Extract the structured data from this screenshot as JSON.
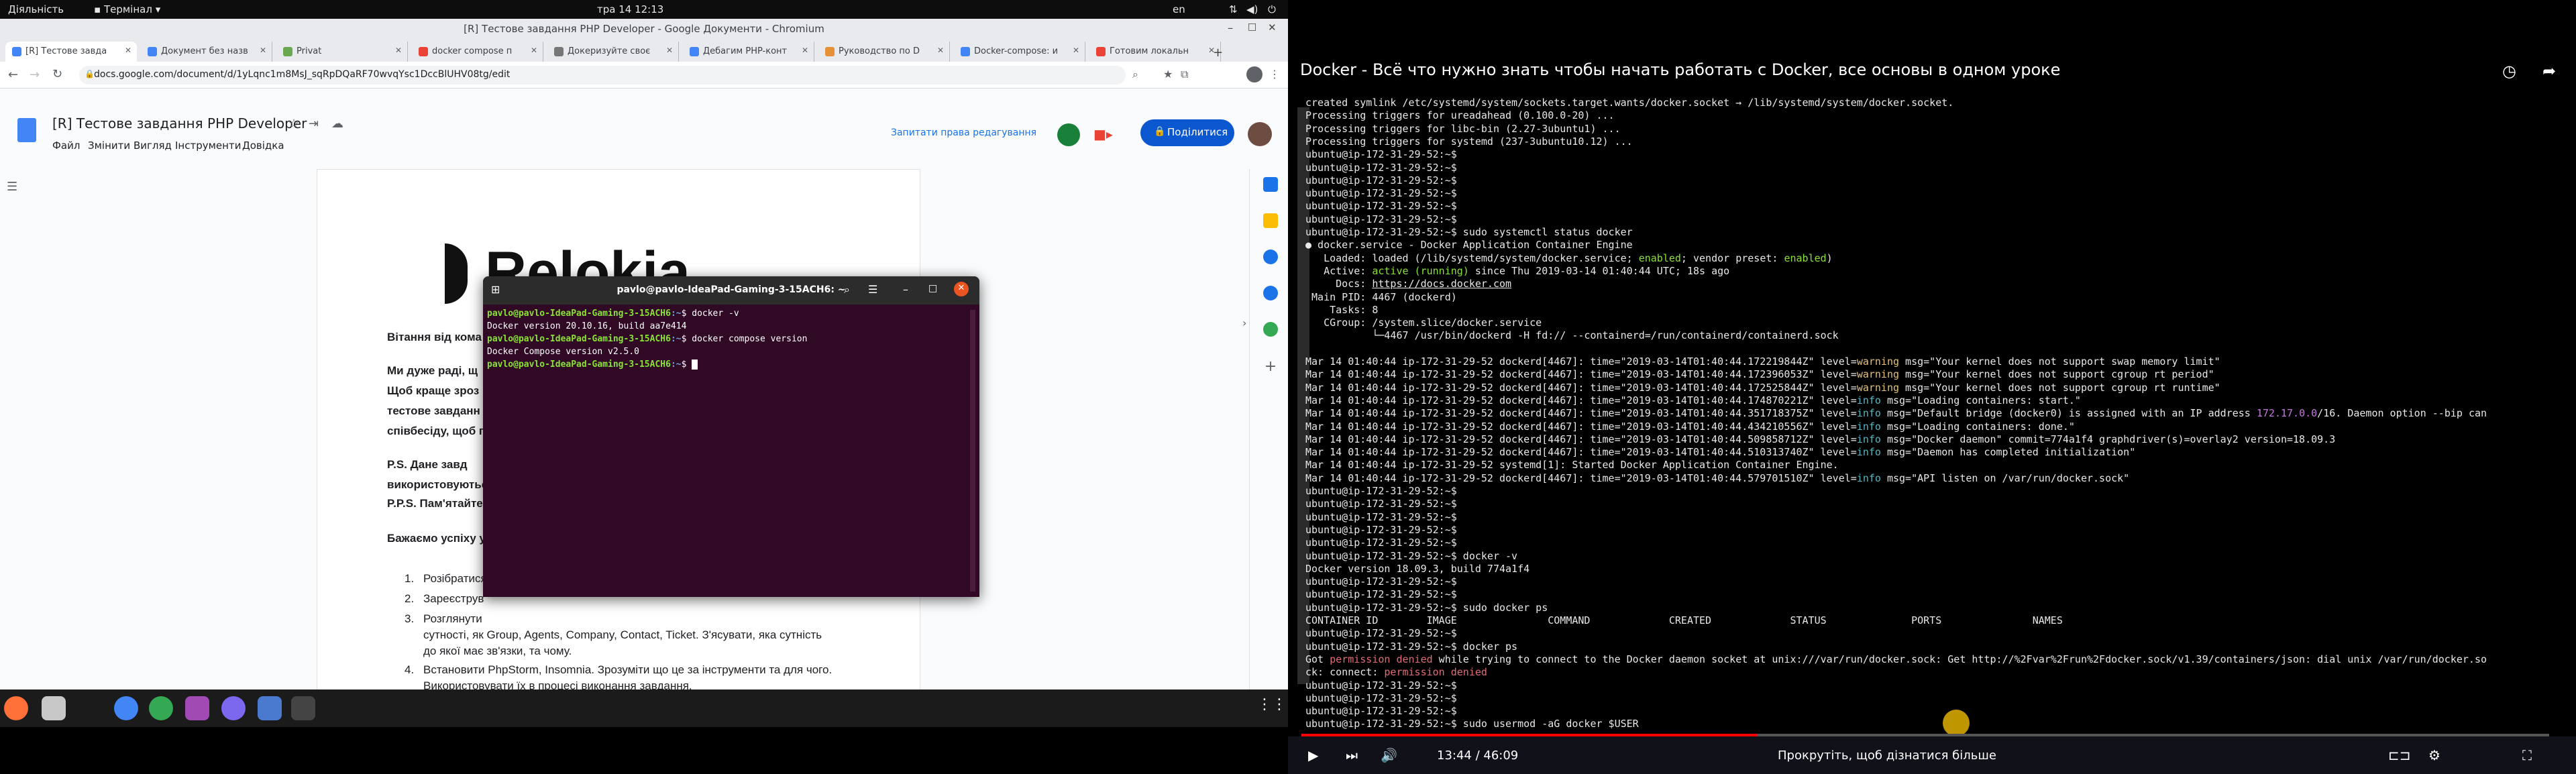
{
  "topbar": {
    "activities": "Діяльність",
    "app": "Термінал",
    "clock": "тра 14  12:13",
    "lang": "en"
  },
  "browser": {
    "window_title": "[R] Тестове завдання PHP Developer - Google Документи - Chromium",
    "tabs": [
      {
        "label": "[R] Тестове завда",
        "color": "#4285f4"
      },
      {
        "label": "Документ без назв",
        "color": "#4285f4"
      },
      {
        "label": "Privat",
        "color": "#6aa84f"
      },
      {
        "label": "docker compose п",
        "color": "#ea4335"
      },
      {
        "label": "Докеризуйте своє",
        "color": "#777777"
      },
      {
        "label": "Дебагим PHP-конт",
        "color": "#4285f4"
      },
      {
        "label": "Руководство по D",
        "color": "#e69138"
      },
      {
        "label": "Docker-compose: и",
        "color": "#4285f4"
      },
      {
        "label": "Готовим локальн",
        "color": "#ea4335"
      }
    ],
    "url": "docs.google.com/document/d/1yLqnc1m8MsJ_sqRpDQaRF70wvqYsc1DccBlUHV08tg/edit"
  },
  "docs": {
    "title": "[R] Тестове завдання PHP Developer",
    "menu": [
      "Файл",
      "Змінити",
      "Вигляд",
      "Інструменти",
      "Довідка"
    ],
    "request_access": "Запитати права редагування",
    "share": "Поділитися",
    "logo": "Relokia",
    "lines": [
      {
        "text": "Вітання від кома",
        "bold": true
      },
      {
        "text": "Ми дуже раді, щ",
        "bold": true
      },
      {
        "text": "Щоб краще зроз",
        "bold": true
      },
      {
        "text": "тестове завданн",
        "bold": true
      },
      {
        "text": "співбесіду, щоб п",
        "bold": true
      },
      {
        "text": "P.S.  Дане  завд",
        "bold": true
      },
      {
        "text": "використовуютьс",
        "bold": true
      },
      {
        "text": "P.P.S. Пам'ятайте",
        "bold": true
      },
      {
        "text": "Бажаємо успіху у",
        "bold": true
      }
    ],
    "list": [
      {
        "n": "1.",
        "text": "Розібратися"
      },
      {
        "n": "2.",
        "text": "Зареєструв"
      },
      {
        "n": "3.",
        "text": "Розглянути"
      },
      {
        "n": "",
        "text": "сутності, як Group, Agents, Company, Contact, Ticket. З'ясувати, яка сутність"
      },
      {
        "n": "",
        "text": "до якої має зв'язки, та чому."
      },
      {
        "n": "4.",
        "text": "Встановити PhpStorm, Insomnia. Зрозуміти що це за інструменти та для чого."
      },
      {
        "n": "",
        "text": "Використовувати їх в процесі виконання завдання."
      },
      {
        "n": "5.",
        "text": "Розібратися що таке Docker, Docker-compose та xDebug, для чого це, як вони"
      },
      {
        "n": "",
        "text": "працюють."
      }
    ]
  },
  "terminal": {
    "title": "pavlo@pavlo-IdeaPad-Gaming-3-15ACH6: ~",
    "prompt_user": "pavlo@pavlo-IdeaPad-Gaming-3-15ACH6",
    "prompt_path": ":~",
    "lines": [
      {
        "cmd": "$ docker -v"
      },
      {
        "out": "Docker version 20.10.16, build aa7e414"
      },
      {
        "cmd": "$ docker compose version"
      },
      {
        "out": "Docker Compose version v2.5.0"
      },
      {
        "cmd": "$ "
      }
    ]
  },
  "video": {
    "title": "Docker - Всё что нужно знать чтобы начать работать с Docker, все основы в одном уроке",
    "time": "13:44 / 46:09",
    "hint": "Прокрутіть, щоб дізнатися більше",
    "lines": [
      {
        "t": "created symlink /etc/systemd/system/sockets.target.wants/docker.socket → /lib/systemd/system/docker.socket."
      },
      {
        "t": "Processing triggers for ureadahead (0.100.0-20) ..."
      },
      {
        "t": "Processing triggers for libc-bin (2.27-3ubuntu1) ..."
      },
      {
        "t": "Processing triggers for systemd (237-3ubuntu10.12) ..."
      },
      {
        "t": "ubuntu@ip-172-31-29-52:~$"
      },
      {
        "t": "ubuntu@ip-172-31-29-52:~$"
      },
      {
        "t": "ubuntu@ip-172-31-29-52:~$"
      },
      {
        "t": "ubuntu@ip-172-31-29-52:~$"
      },
      {
        "t": "ubuntu@ip-172-31-29-52:~$"
      },
      {
        "t": "ubuntu@ip-172-31-29-52:~$"
      },
      {
        "t": "ubuntu@ip-172-31-29-52:~$ sudo systemctl status docker"
      },
      {
        "t": "● docker.service - Docker Application Container Engine"
      },
      {
        "t": "   Loaded: loaded (/lib/systemd/system/docker.service; enabled; vendor preset: enabled)"
      },
      {
        "t": "   Active: active (running) since Thu 2019-03-14 01:40:44 UTC; 18s ago"
      },
      {
        "t": "     Docs: https://docs.docker.com"
      },
      {
        "t": " Main PID: 4467 (dockerd)"
      },
      {
        "t": "    Tasks: 8"
      },
      {
        "t": "   CGroup: /system.slice/docker.service"
      },
      {
        "t": "           └─4467 /usr/bin/dockerd -H fd:// --containerd=/run/containerd/containerd.sock"
      },
      {
        "t": ""
      },
      {
        "t": "Mar 14 01:40:44 ip-172-31-29-52 dockerd[4467]: time=\"2019-03-14T01:40:44.172219844Z\" level=warning msg=\"Your kernel does not support swap memory limit\""
      },
      {
        "t": "Mar 14 01:40:44 ip-172-31-29-52 dockerd[4467]: time=\"2019-03-14T01:40:44.172396053Z\" level=warning msg=\"Your kernel does not support cgroup rt period\""
      },
      {
        "t": "Mar 14 01:40:44 ip-172-31-29-52 dockerd[4467]: time=\"2019-03-14T01:40:44.172525844Z\" level=warning msg=\"Your kernel does not support cgroup rt runtime\""
      },
      {
        "t": "Mar 14 01:40:44 ip-172-31-29-52 dockerd[4467]: time=\"2019-03-14T01:40:44.174870221Z\" level=info msg=\"Loading containers: start.\""
      },
      {
        "t": "Mar 14 01:40:44 ip-172-31-29-52 dockerd[4467]: time=\"2019-03-14T01:40:44.351718375Z\" level=info msg=\"Default bridge (docker0) is assigned with an IP address 172.17.0.0/16. Daemon option --bip can"
      },
      {
        "t": "Mar 14 01:40:44 ip-172-31-29-52 dockerd[4467]: time=\"2019-03-14T01:40:44.434210556Z\" level=info msg=\"Loading containers: done.\""
      },
      {
        "t": "Mar 14 01:40:44 ip-172-31-29-52 dockerd[4467]: time=\"2019-03-14T01:40:44.509858712Z\" level=info msg=\"Docker daemon\" commit=774a1f4 graphdriver(s)=overlay2 version=18.09.3"
      },
      {
        "t": "Mar 14 01:40:44 ip-172-31-29-52 dockerd[4467]: time=\"2019-03-14T01:40:44.510313740Z\" level=info msg=\"Daemon has completed initialization\""
      },
      {
        "t": "Mar 14 01:40:44 ip-172-31-29-52 systemd[1]: Started Docker Application Container Engine."
      },
      {
        "t": "Mar 14 01:40:44 ip-172-31-29-52 dockerd[4467]: time=\"2019-03-14T01:40:44.579701510Z\" level=info msg=\"API listen on /var/run/docker.sock\""
      },
      {
        "t": "ubuntu@ip-172-31-29-52:~$"
      },
      {
        "t": "ubuntu@ip-172-31-29-52:~$"
      },
      {
        "t": "ubuntu@ip-172-31-29-52:~$"
      },
      {
        "t": "ubuntu@ip-172-31-29-52:~$"
      },
      {
        "t": "ubuntu@ip-172-31-29-52:~$"
      },
      {
        "t": "ubuntu@ip-172-31-29-52:~$ docker -v"
      },
      {
        "t": "Docker version 18.09.3, build 774a1f4"
      },
      {
        "t": "ubuntu@ip-172-31-29-52:~$"
      },
      {
        "t": "ubuntu@ip-172-31-29-52:~$"
      },
      {
        "t": "ubuntu@ip-172-31-29-52:~$ sudo docker ps"
      },
      {
        "t": "CONTAINER ID        IMAGE               COMMAND             CREATED             STATUS              PORTS               NAMES"
      },
      {
        "t": "ubuntu@ip-172-31-29-52:~$"
      },
      {
        "t": "ubuntu@ip-172-31-29-52:~$ docker ps"
      },
      {
        "t": "Got permission denied while trying to connect to the Docker daemon socket at unix:///var/run/docker.sock: Get http://%2Fvar%2Frun%2Fdocker.sock/v1.39/containers/json: dial unix /var/run/docker.so"
      },
      {
        "t": "ck: connect: permission denied"
      },
      {
        "t": "ubuntu@ip-172-31-29-52:~$"
      },
      {
        "t": "ubuntu@ip-172-31-29-52:~$"
      },
      {
        "t": "ubuntu@ip-172-31-29-52:~$"
      },
      {
        "t": "ubuntu@ip-172-31-29-52:~$ sudo usermod -aG docker $USER"
      }
    ]
  },
  "colors": {
    "terminal_bg": "#300a24",
    "docs_blue": "#0b57d0",
    "video_bg": "#000000"
  }
}
